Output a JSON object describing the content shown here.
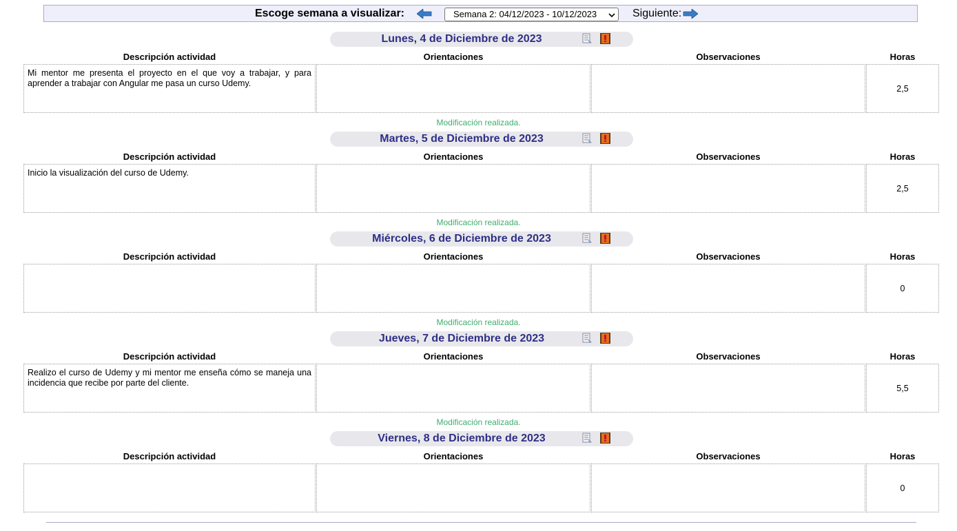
{
  "week_selector": {
    "label": "Escoge semana a visualizar:",
    "selected_week": "Semana 2: 04/12/2023 - 10/12/2023",
    "next_label": "Siguiente:"
  },
  "columns": {
    "description": "Descripción actividad",
    "orientations": "Orientaciones",
    "observations": "Observaciones",
    "hours": "Horas"
  },
  "days": [
    {
      "title": "Lunes, 4 de Diciembre de 2023",
      "status": "",
      "description": "Mi mentor me presenta el proyecto en el que voy a trabajar, y para aprender a trabajar con Angular me pasa un curso Udemy.",
      "orientations": "",
      "observations": "",
      "hours": "2,5"
    },
    {
      "title": "Martes, 5 de Diciembre de 2023",
      "status": "Modificación realizada.",
      "description": "Inicio la visualización del curso de Udemy.",
      "orientations": "",
      "observations": "",
      "hours": "2,5"
    },
    {
      "title": "Miércoles, 6 de Diciembre de 2023",
      "status": "Modificación realizada.",
      "description": "",
      "orientations": "",
      "observations": "",
      "hours": "0"
    },
    {
      "title": "Jueves, 7 de Diciembre de 2023",
      "status": "Modificación realizada.",
      "description": "Realizo el curso de Udemy y mi mentor me enseña cómo se maneja una incidencia que recibe por parte del cliente.",
      "orientations": "",
      "observations": "",
      "hours": "5,5"
    },
    {
      "title": "Viernes, 8 de Diciembre de 2023",
      "status": "Modificación realizada.",
      "description": "",
      "orientations": "",
      "observations": "",
      "hours": "0"
    }
  ],
  "icons": {
    "prev_week": "arrow-left-icon",
    "next_week": "arrow-right-icon",
    "print": "print-document-icon",
    "book": "book-icon"
  },
  "colors": {
    "day_title": "#2e2e86",
    "status_text": "#3fad6d",
    "header_bar": "#efeffb",
    "day_header_bg": "#e8e8ec",
    "arrow": "#3a7cc4"
  }
}
